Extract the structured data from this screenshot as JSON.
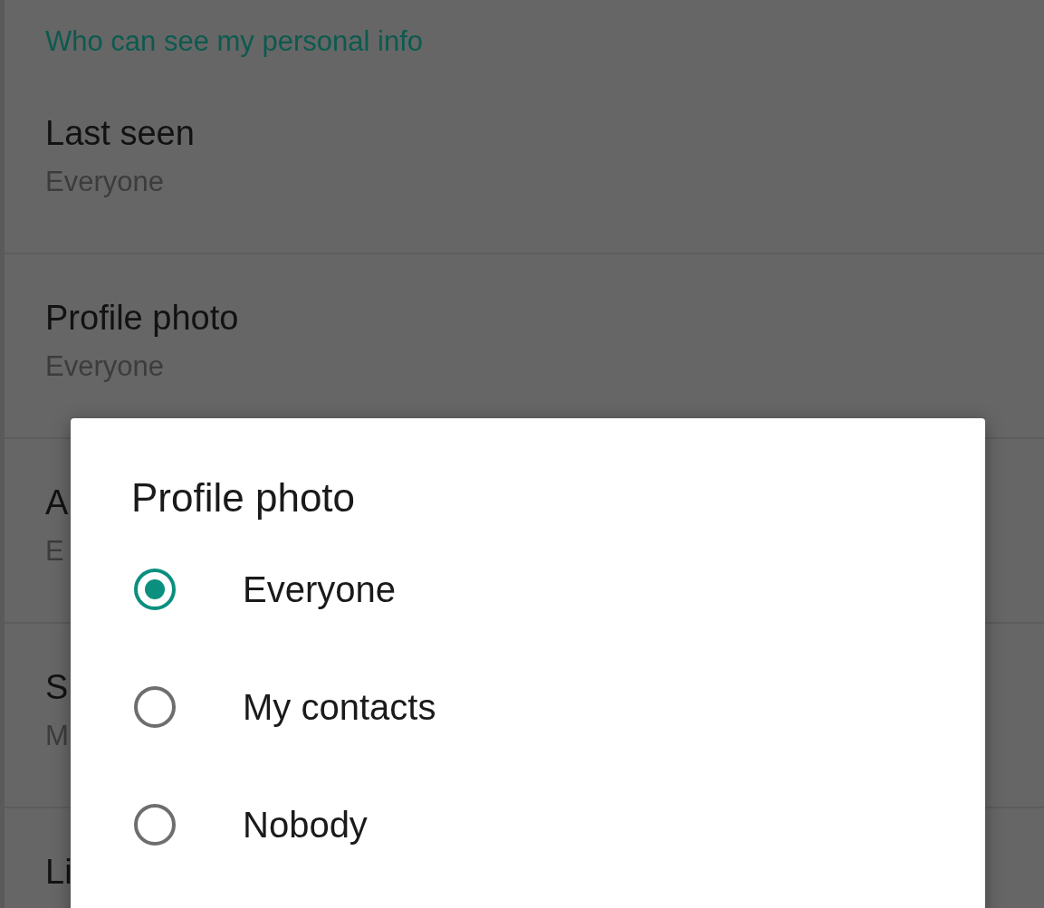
{
  "section_header": "Who can see my personal info",
  "settings": [
    {
      "title": "Last seen",
      "value": "Everyone"
    },
    {
      "title": "Profile photo",
      "value": "Everyone"
    },
    {
      "title": "A",
      "value": "E"
    },
    {
      "title": "S",
      "value": "M"
    },
    {
      "title": "Li"
    }
  ],
  "dialog": {
    "title": "Profile photo",
    "options": [
      {
        "label": "Everyone",
        "selected": true
      },
      {
        "label": "My contacts",
        "selected": false
      },
      {
        "label": "Nobody",
        "selected": false
      }
    ]
  }
}
